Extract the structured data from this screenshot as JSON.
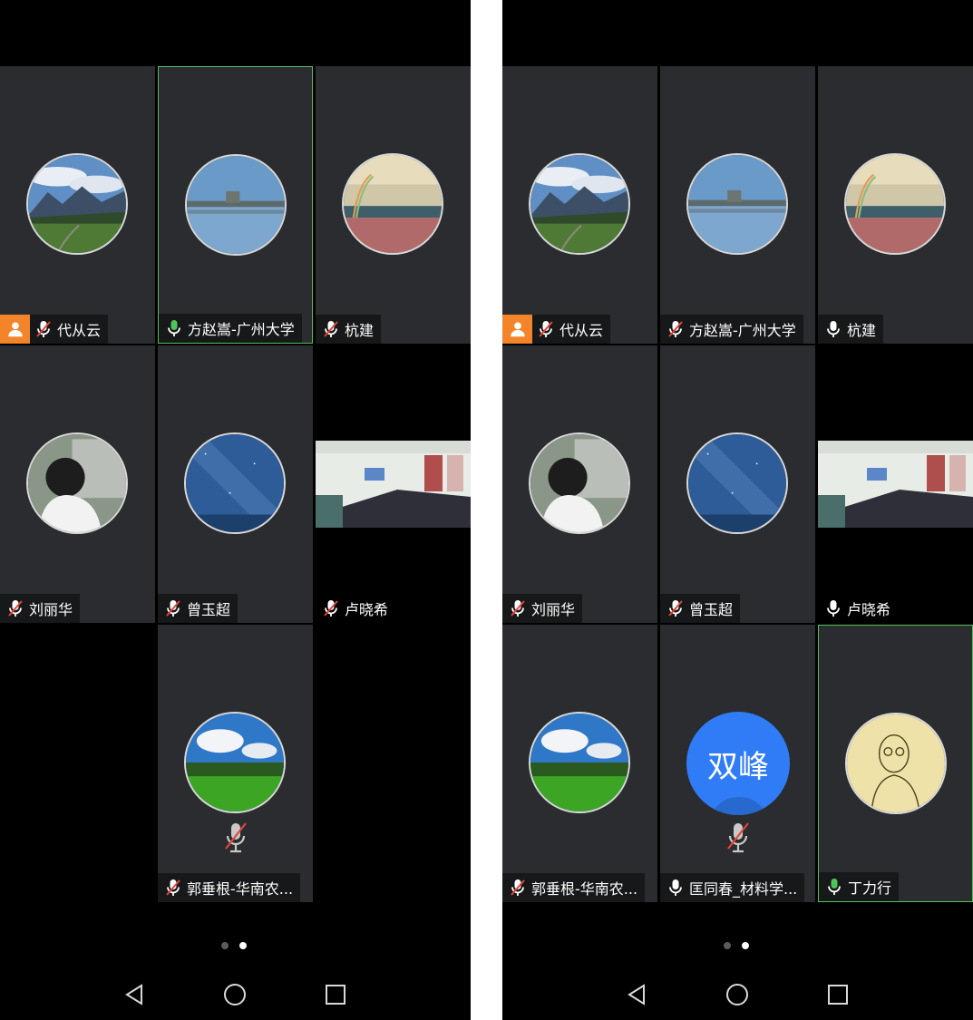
{
  "screens": [
    {
      "page_indicator": {
        "current": 2,
        "total": 2
      },
      "participants": [
        {
          "name": "代从云",
          "mic": "muted",
          "host": true,
          "speaking": false,
          "avatar": "mountain-meadow-avatar"
        },
        {
          "name": "方赵嵩-广州大学",
          "mic": "active",
          "host": false,
          "speaking": true,
          "avatar": "lake-reflection-avatar"
        },
        {
          "name": "杭建",
          "mic": "muted",
          "host": false,
          "speaking": false,
          "avatar": "rainbow-landscape-avatar"
        },
        {
          "name": "刘丽华",
          "mic": "muted",
          "host": false,
          "speaking": false,
          "avatar": "person-photo-avatar"
        },
        {
          "name": "曾玉超",
          "mic": "muted",
          "host": false,
          "speaking": false,
          "avatar": "starry-sky-avatar"
        },
        {
          "name": "卢晓希",
          "mic": "muted",
          "host": false,
          "speaking": false,
          "video": "meeting-room-video"
        },
        {
          "name": "郭垂根-华南农...",
          "mic": "muted",
          "host": false,
          "speaking": false,
          "avatar": "green-park-avatar"
        }
      ]
    },
    {
      "page_indicator": {
        "current": 2,
        "total": 2
      },
      "participants": [
        {
          "name": "代从云",
          "mic": "muted",
          "host": true,
          "speaking": false,
          "avatar": "mountain-meadow-avatar"
        },
        {
          "name": "方赵嵩-广州大学",
          "mic": "muted",
          "host": false,
          "speaking": false,
          "avatar": "lake-reflection-avatar"
        },
        {
          "name": "杭建",
          "mic": "on",
          "host": false,
          "speaking": false,
          "avatar": "rainbow-landscape-avatar"
        },
        {
          "name": "刘丽华",
          "mic": "muted",
          "host": false,
          "speaking": false,
          "avatar": "person-photo-avatar"
        },
        {
          "name": "曾玉超",
          "mic": "muted",
          "host": false,
          "speaking": false,
          "avatar": "starry-sky-avatar"
        },
        {
          "name": "卢晓希",
          "mic": "on",
          "host": false,
          "speaking": false,
          "video": "meeting-room-video"
        },
        {
          "name": "郭垂根-华南农...",
          "mic": "muted",
          "host": false,
          "speaking": false,
          "avatar": "green-park-avatar"
        },
        {
          "name": "匡同春_材料学...",
          "mic": "on",
          "host": false,
          "speaking": false,
          "initials": "双峰"
        },
        {
          "name": "丁力行",
          "mic": "active",
          "host": false,
          "speaking": true,
          "avatar": "sketch-portrait-avatar"
        }
      ]
    }
  ],
  "colors": {
    "tile_bg": "#2b2c2f",
    "speaking_border": "#4fc35a",
    "host_badge": "#f3842a",
    "mic_muted": "#e0453a",
    "mic_active": "#4fc35a",
    "initials_bg": "#2f7cf6"
  }
}
